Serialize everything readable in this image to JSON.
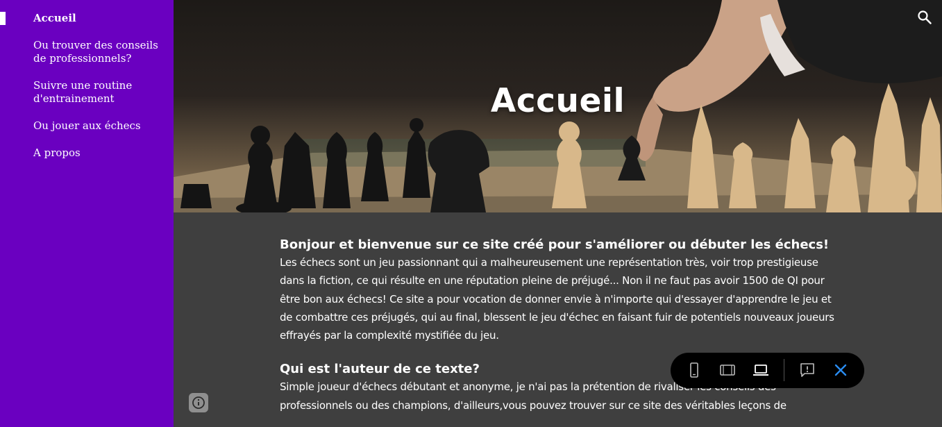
{
  "sidebar": {
    "items": [
      {
        "label": "Accueil",
        "active": true
      },
      {
        "label": "Ou trouver des conseils de professionnels?",
        "active": false
      },
      {
        "label": "Suivre une routine d'entrainement",
        "active": false
      },
      {
        "label": "Ou jouer aux échecs",
        "active": false
      },
      {
        "label": "A propos",
        "active": false
      }
    ]
  },
  "hero": {
    "title": "Accueil",
    "search_icon": "search-icon"
  },
  "content": {
    "heading_1": "Bonjour et bienvenue sur ce site créé pour s'améliorer ou débuter les échecs!",
    "paragraph_1": "Les échecs sont un jeu passionnant qui a malheureusement une représentation très, voir trop prestigieuse dans la fiction, ce qui résulte en une réputation pleine de préjugé... Non il ne faut pas avoir 1500 de QI pour être bon aux échecs! Ce site a pour vocation de donner envie à n'importe qui d'essayer d'apprendre le jeu et de combattre ces préjugés, qui au final, blessent le jeu d'échec en faisant fuir de potentiels nouveaux joueurs effrayés par la complexité mystifiée du jeu.",
    "heading_2": "Qui est l'auteur de ce texte?",
    "paragraph_2": "Simple joueur d'échecs débutant et anonyme, je n'ai pas la prétention de rivaliser les conseils des professionnels ou des champions, d'ailleurs,vous pouvez trouver sur ce site des véritables leçons de"
  },
  "toolbar": {
    "icons": [
      "phone-view-icon",
      "tablet-view-icon",
      "laptop-view-icon",
      "report-icon",
      "close-icon"
    ],
    "close_color": "#1a73e8"
  },
  "colors": {
    "sidebar_bg": "#6a00c0",
    "content_bg": "#3f3f3f",
    "text": "#ffffff"
  }
}
